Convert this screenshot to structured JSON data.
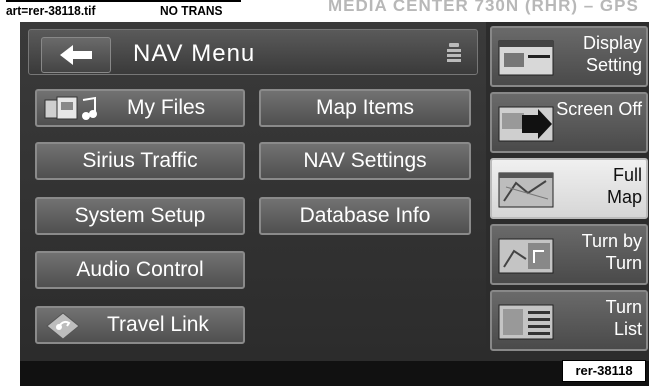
{
  "doc_header": {
    "art_label": "art=rer-38118.tif",
    "trans_label": "NO TRANS",
    "chapter_title": "MEDIA CENTER 730N (RHR) – GPS"
  },
  "header": {
    "title": "NAV Menu",
    "back_icon": "back-arrow-icon",
    "options_icon": "options-icon"
  },
  "menu": {
    "left": [
      {
        "label": "My Files",
        "icon": "my-files-icon"
      },
      {
        "label": "Sirius Traffic"
      },
      {
        "label": "System Setup"
      },
      {
        "label": "Audio Control"
      },
      {
        "label": "Travel Link",
        "icon": "travel-link-icon"
      }
    ],
    "right": [
      {
        "label": "Map Items"
      },
      {
        "label": "NAV Settings"
      },
      {
        "label": "Database Info"
      }
    ]
  },
  "side_menu": [
    {
      "label": "Display Setting",
      "icon": "display-setting-icon",
      "active": false
    },
    {
      "label": "Screen Off",
      "icon": "screen-off-icon",
      "active": false
    },
    {
      "label": "Full Map",
      "icon": "full-map-icon",
      "active": true
    },
    {
      "label": "Turn by Turn",
      "icon": "turn-by-turn-icon",
      "active": false
    },
    {
      "label": "Turn List",
      "icon": "turn-list-icon",
      "active": false
    }
  ],
  "figure_ref": "rer-38118",
  "colors": {
    "screen_bg": "#2a2a2a",
    "button_face": "#5f5f5f",
    "active_button": "#e6e6e6",
    "text": "#ffffff"
  }
}
